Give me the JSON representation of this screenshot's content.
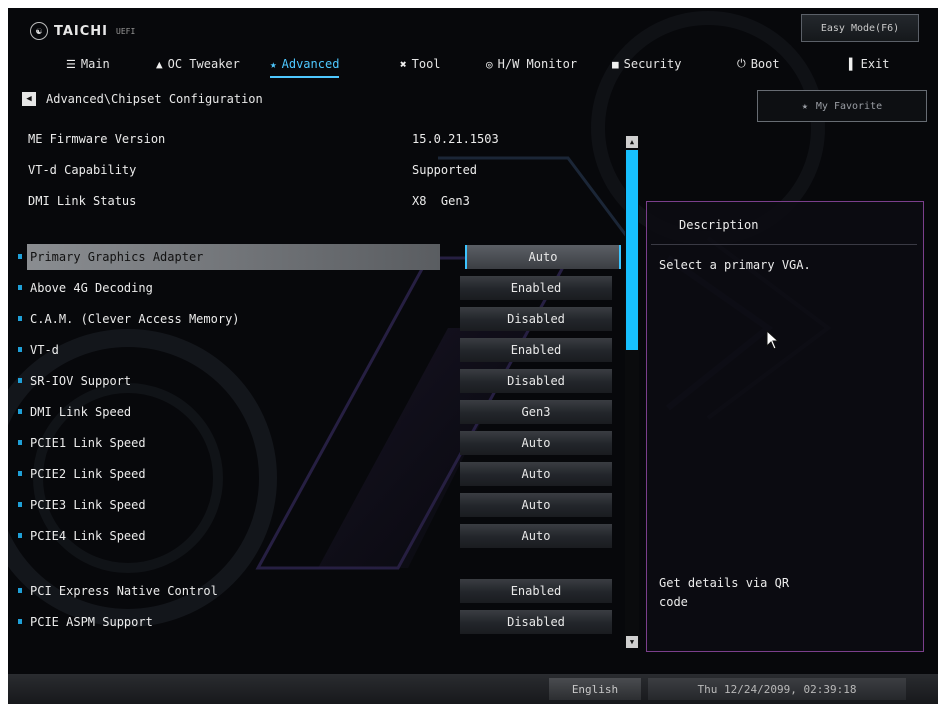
{
  "header": {
    "logo_text": "TAICHI",
    "logo_sub": "UEFI",
    "easy_mode_label": "Easy Mode(F6)"
  },
  "tabs": [
    {
      "label": "Main",
      "icon": "list-icon"
    },
    {
      "label": "OC Tweaker",
      "icon": "rocket-icon"
    },
    {
      "label": "Advanced",
      "icon": "star-icon",
      "active": true
    },
    {
      "label": "Tool",
      "icon": "tools-icon"
    },
    {
      "label": "H/W Monitor",
      "icon": "monitor-icon"
    },
    {
      "label": "Security",
      "icon": "shield-icon"
    },
    {
      "label": "Boot",
      "icon": "power-icon"
    },
    {
      "label": "Exit",
      "icon": "exit-icon"
    }
  ],
  "breadcrumb": "Advanced\\Chipset Configuration",
  "favorite_label": "My Favorite",
  "info": [
    {
      "label": "ME Firmware Version",
      "value": "15.0.21.1503"
    },
    {
      "label": "VT-d Capability",
      "value": "Supported"
    },
    {
      "label": "DMI Link Status",
      "value": "X8  Gen3"
    }
  ],
  "settings": [
    {
      "label": "Primary Graphics Adapter",
      "value": "Auto",
      "selected": true
    },
    {
      "label": "Above 4G Decoding",
      "value": "Enabled"
    },
    {
      "label": "C.A.M. (Clever Access Memory)",
      "value": "Disabled"
    },
    {
      "label": "VT-d",
      "value": "Enabled"
    },
    {
      "label": "SR-IOV Support",
      "value": "Disabled"
    },
    {
      "label": "DMI Link Speed",
      "value": "Gen3"
    },
    {
      "label": "PCIE1 Link Speed",
      "value": "Auto"
    },
    {
      "label": "PCIE2 Link Speed",
      "value": "Auto"
    },
    {
      "label": "PCIE3 Link Speed",
      "value": "Auto"
    },
    {
      "label": "PCIE4 Link Speed",
      "value": "Auto"
    },
    {
      "label": "PCI Express Native Control",
      "value": "Enabled"
    },
    {
      "label": "PCIE ASPM Support",
      "value": "Disabled"
    }
  ],
  "description": {
    "title": "Description",
    "text": "Select a primary VGA.",
    "qr_text": "Get details via QR code"
  },
  "footer": {
    "language": "English",
    "datetime": "Thu 12/24/2099, 02:39:18"
  },
  "colors": {
    "accent": "#4ec8ff",
    "scroll_thumb": "#17c0ff",
    "panel_border": "#7b3f8c"
  }
}
